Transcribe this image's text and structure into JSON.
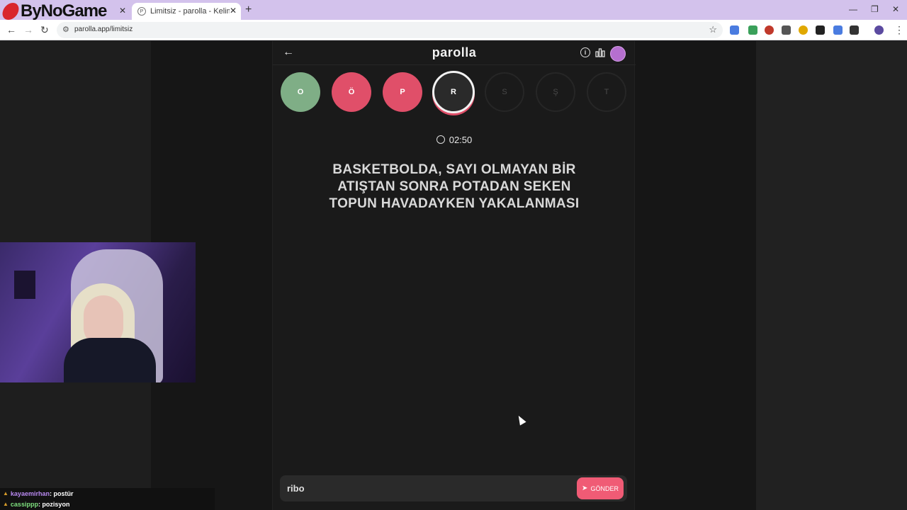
{
  "browser": {
    "logo_text": "ByNoGame",
    "inactive_tab_close": "✕",
    "active_tab": {
      "favicon": "P",
      "title": "Limitsiz - parolla - Kelime oyunu",
      "close": "✕"
    },
    "new_tab": "+",
    "window_controls": [
      "—",
      "❐",
      "✕"
    ],
    "url": "parolla.app/limitsiz"
  },
  "app": {
    "brand": "parolla",
    "back_icon": "←",
    "letters": [
      {
        "letter": "O",
        "state": "correct"
      },
      {
        "letter": "Ö",
        "state": "wrong"
      },
      {
        "letter": "P",
        "state": "wrong"
      },
      {
        "letter": "R",
        "state": "current"
      },
      {
        "letter": "S",
        "state": "pending"
      },
      {
        "letter": "Ş",
        "state": "pending"
      },
      {
        "letter": "T",
        "state": "pending"
      }
    ],
    "timer": "02:50",
    "question": "BASKETBOLDA, SAYI OLMAYAN BİR ATIŞTAN SONRA POTADAN SEKEN TOPUN HAVADAYKEN YAKALANMASI",
    "answer_value": "ribo",
    "send_label": "GÖNDER"
  },
  "chat": [
    {
      "user": "kayaemirhan",
      "message": ": postür"
    },
    {
      "user": "cassippp",
      "message": ": pozisyon"
    }
  ],
  "colors": {
    "correct": "#7fae86",
    "wrong": "#e04f69",
    "send": "#f05b75",
    "tabbar": "#d3c2ec"
  }
}
